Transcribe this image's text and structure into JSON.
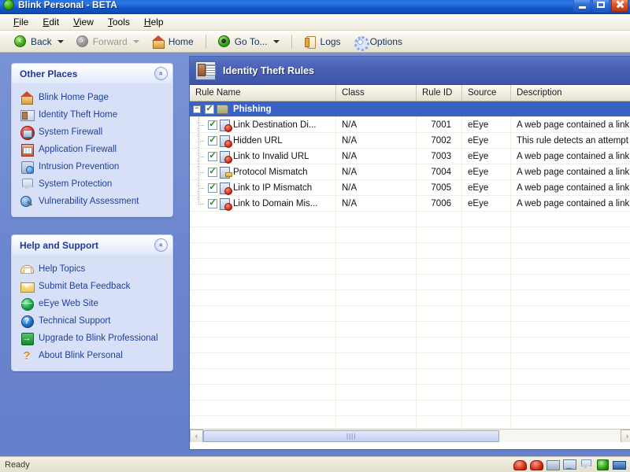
{
  "window": {
    "title": "Blink Personal - BETA",
    "app_icon": "blink-green-orb-icon",
    "minimize_label": "Minimize",
    "maximize_label": "Maximize",
    "close_label": "Close"
  },
  "menubar": {
    "items": [
      {
        "label": "File"
      },
      {
        "label": "Edit"
      },
      {
        "label": "View"
      },
      {
        "label": "Tools"
      },
      {
        "label": "Help"
      }
    ]
  },
  "toolbar": {
    "buttons": [
      {
        "label": "Back",
        "icon": "back-arrow-icon",
        "has_caret": true,
        "disabled": false
      },
      {
        "label": "Forward",
        "icon": "forward-arrow-icon",
        "has_caret": true,
        "disabled": true
      },
      {
        "label": "Home",
        "icon": "home-icon",
        "has_caret": false,
        "disabled": false
      },
      {
        "label": "Go To...",
        "icon": "goto-icon",
        "has_caret": true,
        "disabled": false
      },
      {
        "label": "Logs",
        "icon": "logs-icon",
        "has_caret": false,
        "disabled": false
      },
      {
        "label": "Options",
        "icon": "gear-icon",
        "has_caret": false,
        "disabled": false
      }
    ]
  },
  "sidebar": {
    "panels": [
      {
        "title": "Other Places",
        "collapse_glyph": "«",
        "items": [
          {
            "label": "Blink Home Page",
            "icon": "home-icon"
          },
          {
            "label": "Identity Theft Home",
            "icon": "id-card-icon"
          },
          {
            "label": "System Firewall",
            "icon": "firewall-icon"
          },
          {
            "label": "Application Firewall",
            "icon": "application-firewall-icon"
          },
          {
            "label": "Intrusion Prevention",
            "icon": "intrusion-prevention-icon"
          },
          {
            "label": "System Protection",
            "icon": "shield-icon"
          },
          {
            "label": "Vulnerability Assessment",
            "icon": "vulnerability-scan-icon"
          }
        ]
      },
      {
        "title": "Help and Support",
        "collapse_glyph": "«",
        "items": [
          {
            "label": "Help Topics",
            "icon": "help-book-icon"
          },
          {
            "label": "Submit Beta Feedback",
            "icon": "mail-icon"
          },
          {
            "label": "eEye Web Site",
            "icon": "globe-icon"
          },
          {
            "label": "Technical Support",
            "icon": "question-circle-icon"
          },
          {
            "label": "Upgrade to Blink Professional",
            "icon": "upgrade-arrow-icon"
          },
          {
            "label": "About Blink Personal",
            "icon": "question-mark-icon"
          }
        ]
      }
    ]
  },
  "content": {
    "header": {
      "title": "Identity Theft Rules",
      "icon": "identity-theft-icon"
    },
    "table": {
      "columns": [
        "Rule Name",
        "Class",
        "Rule ID",
        "Source",
        "Description"
      ],
      "group": {
        "label": "Phishing",
        "checked": true,
        "expanded": true,
        "expander_glyph": "−",
        "check_glyph": "✓"
      },
      "rows": [
        {
          "name": "Link Destination Di...",
          "class": "N/A",
          "rule_id": "7001",
          "source": "eEye",
          "description": "A web page contained a link t",
          "checked": true,
          "icon": "rule-alert-icon"
        },
        {
          "name": "Hidden URL",
          "class": "N/A",
          "rule_id": "7002",
          "source": "eEye",
          "description": "This rule detects an attempt t",
          "checked": true,
          "icon": "rule-alert-icon"
        },
        {
          "name": "Link to Invalid URL",
          "class": "N/A",
          "rule_id": "7003",
          "source": "eEye",
          "description": "A web page contained a link t",
          "checked": true,
          "icon": "rule-alert-icon"
        },
        {
          "name": "Protocol Mismatch",
          "class": "N/A",
          "rule_id": "7004",
          "source": "eEye",
          "description": "A web page contained a link t",
          "checked": true,
          "icon": "rule-plain-icon"
        },
        {
          "name": "Link to IP Mismatch",
          "class": "N/A",
          "rule_id": "7005",
          "source": "eEye",
          "description": "A web page contained a link t",
          "checked": true,
          "icon": "rule-alert-icon"
        },
        {
          "name": "Link to Domain Mis...",
          "class": "N/A",
          "rule_id": "7006",
          "source": "eEye",
          "description": "A web page contained a link t",
          "checked": true,
          "icon": "rule-alert-icon"
        }
      ],
      "empty_row_count": 15
    },
    "hscroll": {
      "left_glyph": "‹",
      "right_glyph": "›",
      "grip": "||||"
    }
  },
  "statusbar": {
    "text": "Ready",
    "tray_icons": [
      "tray-firewall-red-icon",
      "tray-alert-red-icon",
      "tray-gray-icon",
      "tray-monitor-icon",
      "tray-shield-icon",
      "tray-green-icon",
      "tray-blue-icon"
    ]
  },
  "colors": {
    "title_blue": "#1457c9",
    "desktop_blue": "#6c86ce",
    "panel_header_blue": "#4a60b4",
    "selection_blue": "#3a62c4",
    "sidebar_panel": "#d8e0f8",
    "link_blue": "#21409a"
  }
}
